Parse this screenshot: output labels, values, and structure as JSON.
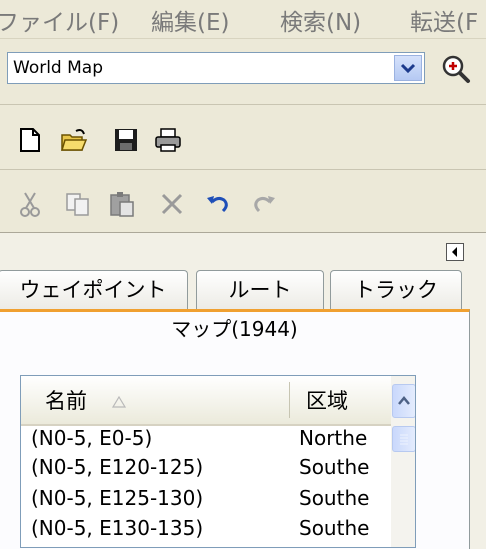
{
  "menu": {
    "items": [
      {
        "label": "ファイル(F)"
      },
      {
        "label": "編集(E)"
      },
      {
        "label": "検索(N)"
      },
      {
        "label": "転送(F"
      }
    ]
  },
  "map_select": {
    "value": "World Map"
  },
  "icons": {
    "zoom": "zoom-in-icon",
    "toolbar1": [
      "new-file-icon",
      "open-folder-icon",
      "save-icon",
      "print-icon"
    ],
    "toolbar2": [
      "cut-icon",
      "copy-icon",
      "paste-icon",
      "delete-icon",
      "undo-icon",
      "redo-icon"
    ]
  },
  "tabs": [
    {
      "label": "ウェイポイント"
    },
    {
      "label": "ルート"
    },
    {
      "label": "トラック"
    }
  ],
  "active_tab": {
    "label": "マップ(1944)"
  },
  "table": {
    "columns": [
      "名前",
      "区域"
    ],
    "rows": [
      {
        "name": "(N0-5, E0-5)",
        "region": "Northe"
      },
      {
        "name": "(N0-5, E120-125)",
        "region": "Southe"
      },
      {
        "name": "(N0-5, E125-130)",
        "region": "Southe"
      },
      {
        "name": "(N0-5, E130-135)",
        "region": "Southe"
      }
    ]
  },
  "colors": {
    "active_tab_accent": "#f0a030",
    "scrollbar": "#c9d8fc"
  }
}
